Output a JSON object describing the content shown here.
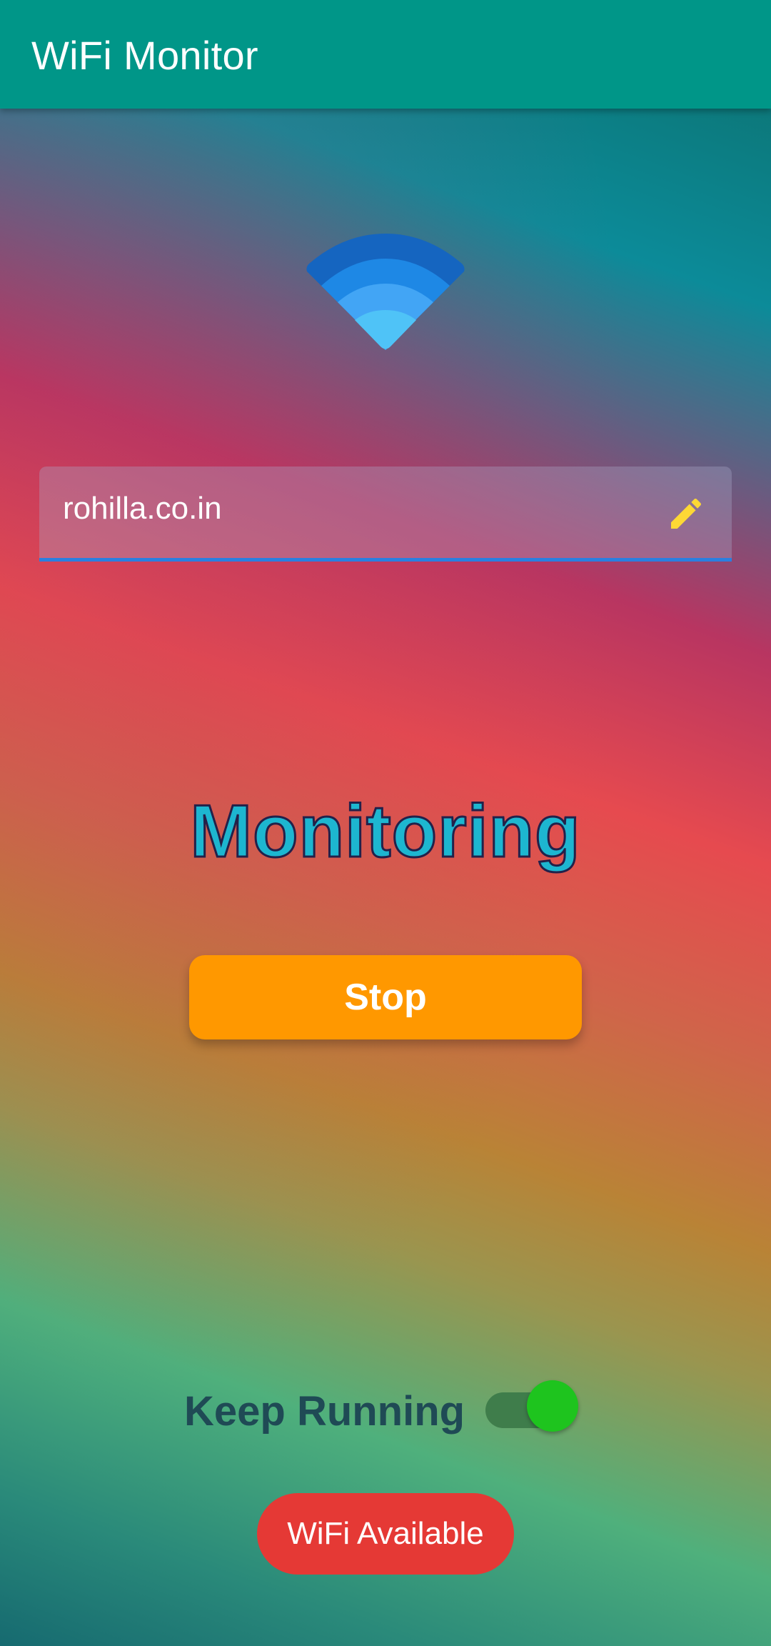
{
  "app_bar": {
    "title": "WiFi Monitor",
    "background_color": "#009688"
  },
  "wifi_icon": {
    "name": "wifi-icon",
    "colors": [
      "#1565c0",
      "#1e88e5",
      "#42a5f5",
      "#4fc3f7"
    ]
  },
  "url_field": {
    "value": "rohilla.co.in",
    "edit_icon": "pencil-icon",
    "edit_icon_color": "#fdd835",
    "underline_color": "#2a7fe0"
  },
  "status": {
    "heading": "Monitoring",
    "color": "#1db6d0"
  },
  "actions": {
    "stop_label": "Stop",
    "stop_color": "#ff9800"
  },
  "keep_running": {
    "label": "Keep Running",
    "enabled": true,
    "thumb_color": "#1ec41e"
  },
  "badge": {
    "label": "WiFi Available",
    "color": "#e53935"
  }
}
